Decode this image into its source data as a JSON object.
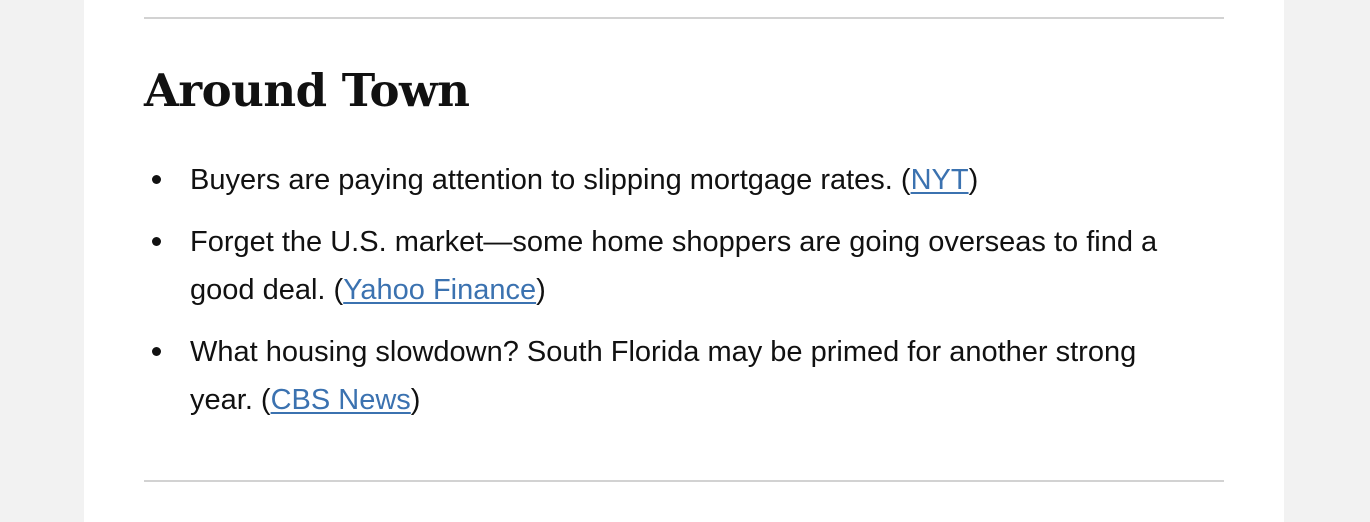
{
  "section": {
    "heading": "Around Town",
    "items": [
      {
        "text": "Buyers are paying attention to slipping mortgage rates.",
        "open_paren": " (",
        "source": "NYT",
        "close_paren": ")"
      },
      {
        "text": "Forget the U.S. market—some home shoppers are going overseas to find a good deal.",
        "open_paren": " (",
        "source": "Yahoo Finance",
        "close_paren": ")"
      },
      {
        "text": "What housing slowdown? South Florida may be primed for another strong year.",
        "open_paren": " (",
        "source": "CBS News",
        "close_paren": ")"
      }
    ]
  },
  "colors": {
    "link": "#3b72b0",
    "text": "#111111",
    "divider": "#d2d2d2",
    "page_background": "#f2f2f2",
    "card_background": "#ffffff"
  }
}
